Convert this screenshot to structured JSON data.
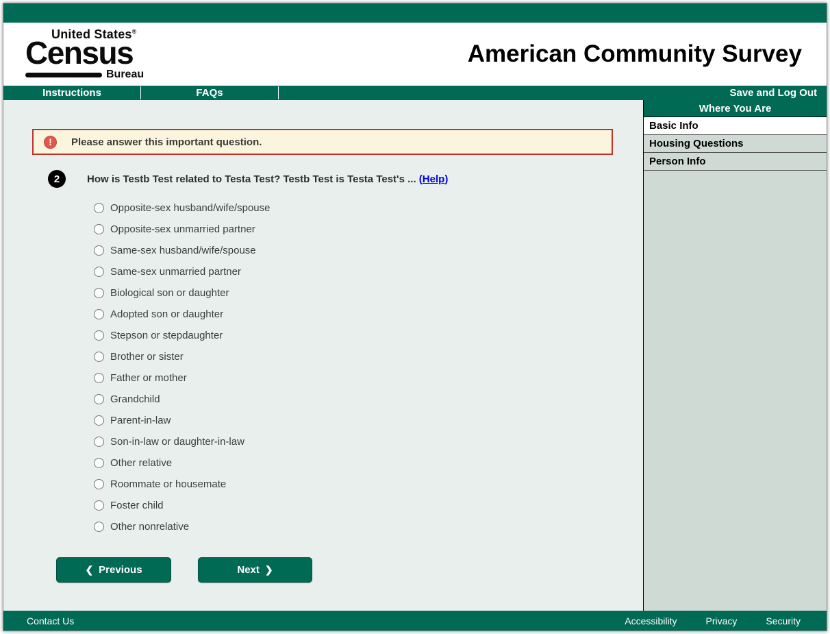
{
  "header": {
    "logo_top": "United States",
    "logo_reg": "®",
    "logo_main": "Census",
    "logo_sub": "Bureau",
    "title": "American Community Survey"
  },
  "nav": {
    "instructions": "Instructions",
    "faqs": "FAQs",
    "save_logout": "Save and Log Out"
  },
  "sidebar": {
    "title": "Where You Are",
    "items": [
      {
        "label": "Basic Info",
        "active": true
      },
      {
        "label": "Housing Questions",
        "active": false
      },
      {
        "label": "Person Info",
        "active": false
      }
    ]
  },
  "alert": {
    "icon": "warning-exclamation-icon",
    "glyph": "!",
    "text": "Please answer this important question."
  },
  "question": {
    "number": "2",
    "text": "How is Testb Test related to Testa Test? Testb Test is Testa Test's ...",
    "help_open": "(",
    "help_label": "Help",
    "help_close": ")",
    "options": [
      "Opposite-sex husband/wife/spouse",
      "Opposite-sex unmarried partner",
      "Same-sex husband/wife/spouse",
      "Same-sex unmarried partner",
      "Biological son or daughter",
      "Adopted son or daughter",
      "Stepson or stepdaughter",
      "Brother or sister",
      "Father or mother",
      "Grandchild",
      "Parent-in-law",
      "Son-in-law or daughter-in-law",
      "Other relative",
      "Roommate or housemate",
      "Foster child",
      "Other nonrelative"
    ],
    "selected": null
  },
  "buttons": {
    "previous": "Previous",
    "next": "Next",
    "prev_chevron": "❮",
    "next_chevron": "❯"
  },
  "footer": {
    "contact": "Contact Us",
    "links": [
      "Accessibility",
      "Privacy",
      "Security"
    ]
  },
  "colors": {
    "brand_green": "#006a55",
    "page_bg": "#e8efec",
    "sidebar_bg": "#cedad3",
    "alert_bg": "#fcf5de",
    "alert_border": "#c4302c",
    "link_blue": "#0000ee"
  }
}
